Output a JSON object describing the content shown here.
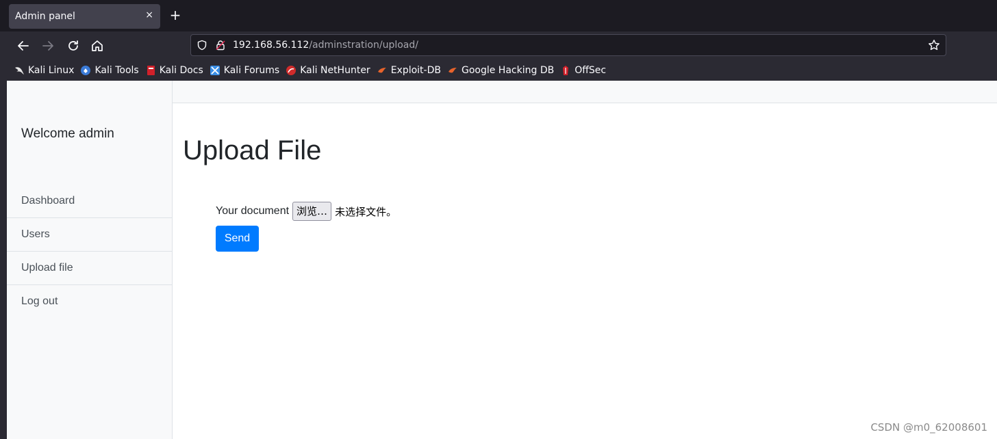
{
  "browser": {
    "tab_title": "Admin panel",
    "tab_close": "×",
    "new_tab": "+",
    "url_host": "192.168.56.112",
    "url_path": "/adminstration/upload/"
  },
  "bookmarks": [
    {
      "label": "Kali Linux",
      "icon": "kali-dragon-icon",
      "color": "#e0e0e0"
    },
    {
      "label": "Kali Tools",
      "icon": "kali-tools-icon",
      "color": "#3b7bd8"
    },
    {
      "label": "Kali Docs",
      "icon": "kali-docs-icon",
      "color": "#d1202a"
    },
    {
      "label": "Kali Forums",
      "icon": "kali-forums-icon",
      "color": "#3a8ee6"
    },
    {
      "label": "Kali NetHunter",
      "icon": "kali-nethunter-icon",
      "color": "#d12b2b"
    },
    {
      "label": "Exploit-DB",
      "icon": "exploit-db-icon",
      "color": "#e8632b"
    },
    {
      "label": "Google Hacking DB",
      "icon": "ghdb-icon",
      "color": "#e8632b"
    },
    {
      "label": "OffSec",
      "icon": "offsec-icon",
      "color": "#d1202a"
    }
  ],
  "sidebar": {
    "welcome": "Welcome admin",
    "items": [
      {
        "label": "Dashboard"
      },
      {
        "label": "Users"
      },
      {
        "label": "Upload file"
      },
      {
        "label": "Log out"
      }
    ]
  },
  "main": {
    "title": "Upload File",
    "field_label": "Your document",
    "browse_label": "浏览…",
    "no_file_text": "未选择文件。",
    "send_label": "Send"
  },
  "watermark": "CSDN @m0_62008601",
  "colors": {
    "primary": "#007bff",
    "sidebar_bg": "#f8f9fa",
    "chrome_bg": "#2b2a33"
  }
}
